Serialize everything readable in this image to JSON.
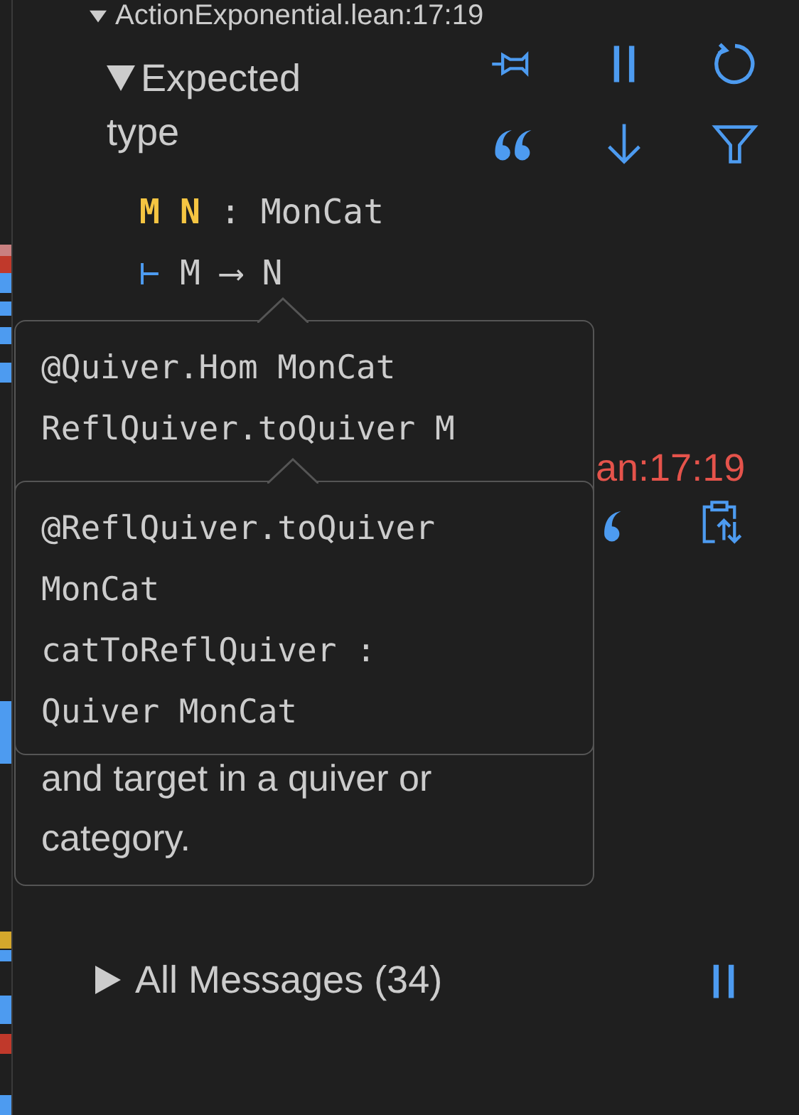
{
  "file_header": {
    "label": "ActionExponential.lean:17:19",
    "expanded": true
  },
  "expected_type": {
    "title": "Expected type",
    "expanded": true,
    "hypotheses": [
      {
        "names": [
          "M",
          "N"
        ],
        "separator": ":",
        "type": "MonCat"
      }
    ],
    "goal": {
      "turnstile": "⊢",
      "text": "M ⟶ N"
    }
  },
  "hidden_location": {
    "text": "an:17:19"
  },
  "all_messages": {
    "label": "All Messages (34)",
    "expanded": false
  },
  "tooltips": [
    {
      "code_lines": [
        "@Quiver.Hom MonCat",
        "ReflQuiver.toQuiver M"
      ],
      "doc": "and target in a quiver or category."
    },
    {
      "code_lines": [
        "@ReflQuiver.toQuiver",
        "MonCat",
        "catToReflQuiver :",
        "Quiver MonCat"
      ]
    }
  ]
}
